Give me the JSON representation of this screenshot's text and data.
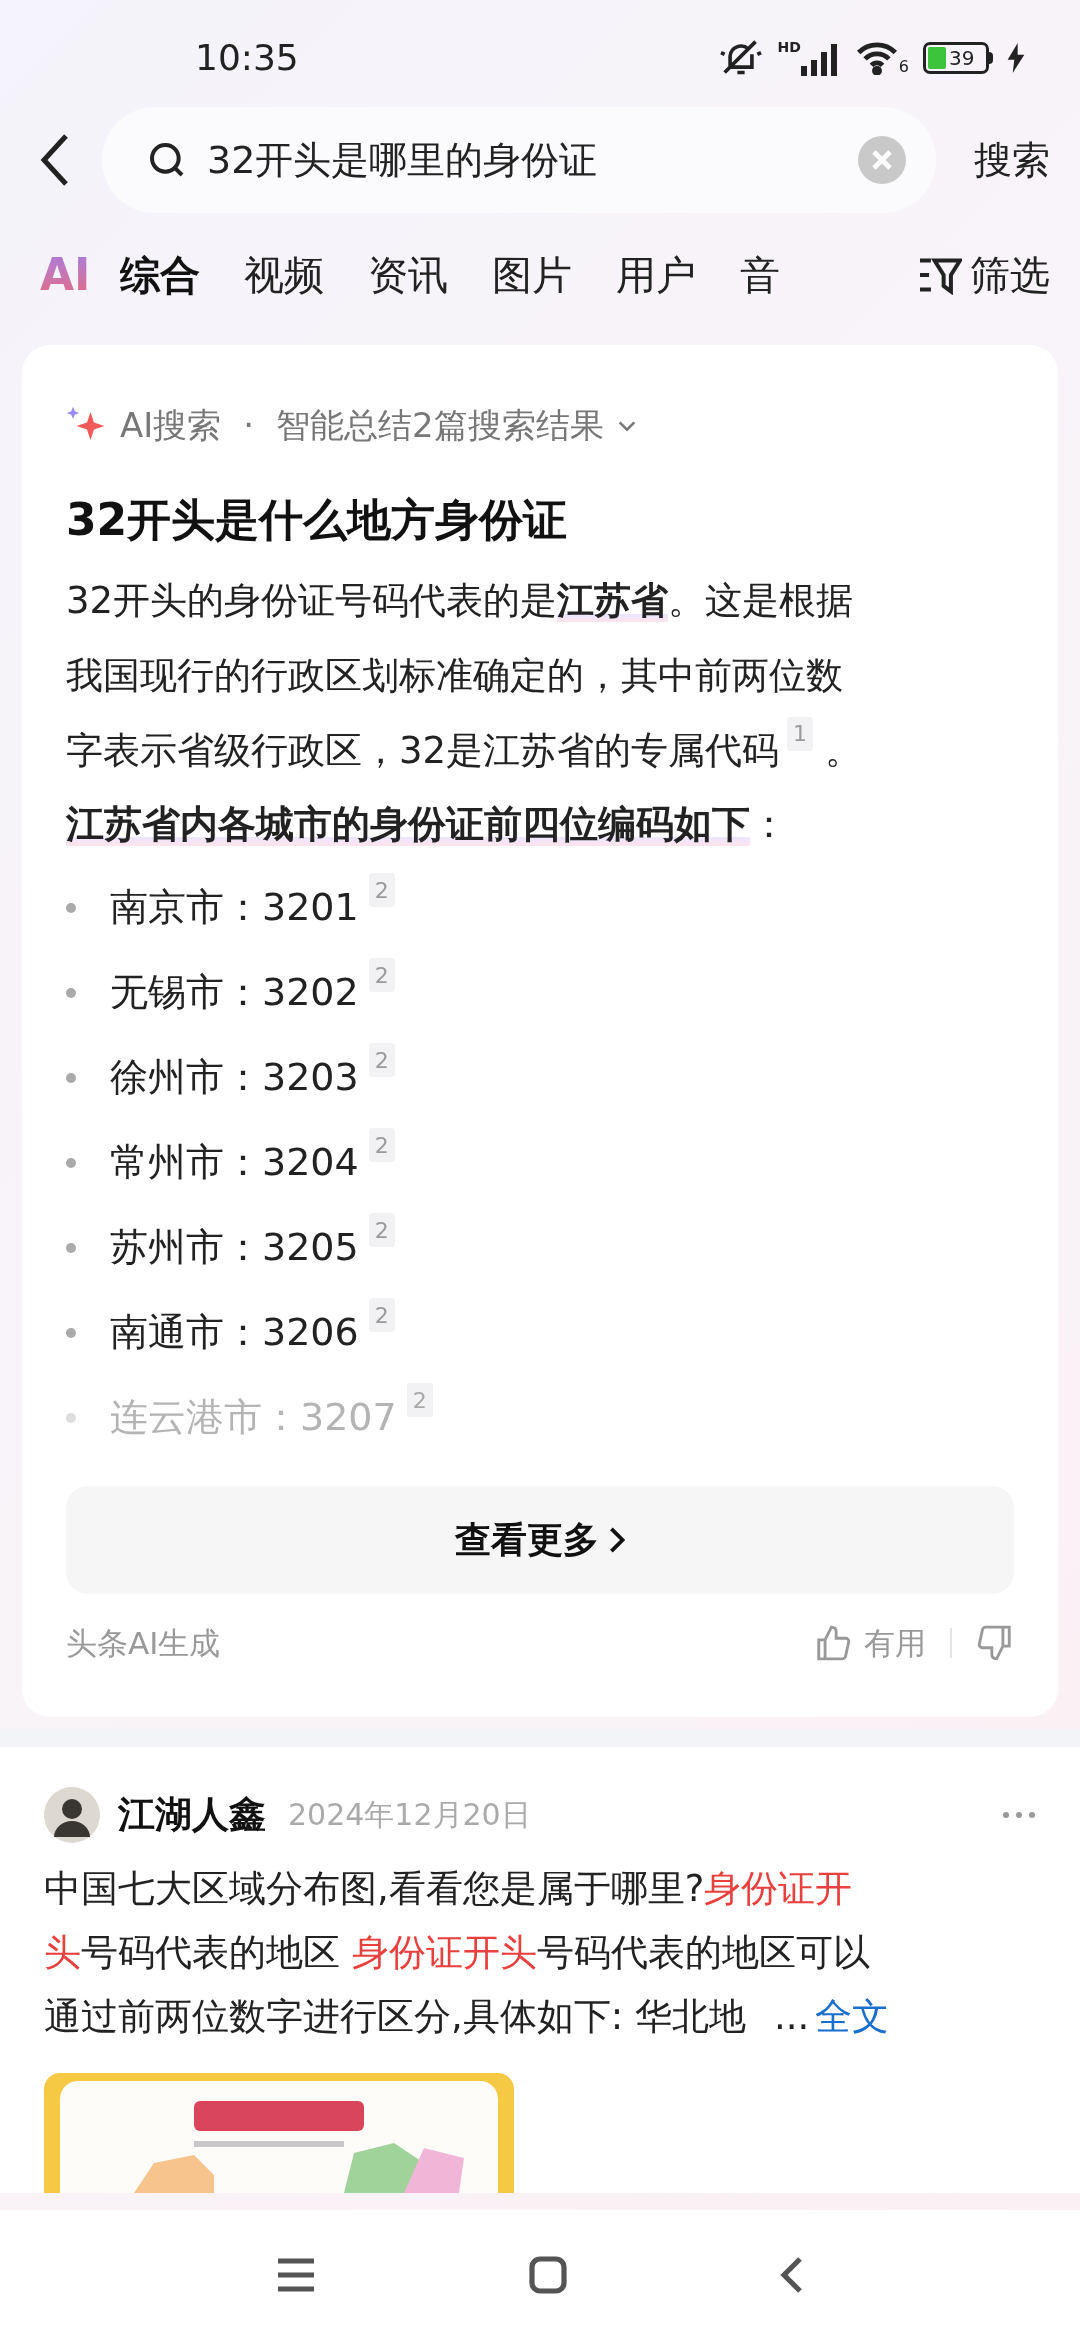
{
  "status_bar": {
    "time": "10:35",
    "network": "HD",
    "wifi_badge": "6",
    "battery": "39"
  },
  "search": {
    "query": "32开头是哪里的身份证",
    "button": "搜索"
  },
  "tabs_logo": "AI",
  "tabs": [
    {
      "label": "综合",
      "selected": true
    },
    {
      "label": "视频",
      "selected": false
    },
    {
      "label": "资讯",
      "selected": false
    },
    {
      "label": "图片",
      "selected": false
    },
    {
      "label": "用户",
      "selected": false
    },
    {
      "label": "音",
      "selected": false
    }
  ],
  "filter": "筛选",
  "ai_card": {
    "source": "AI搜索",
    "separator": "·",
    "summary_info": "智能总结2篇搜索结果",
    "title": "32开头是什么地方身份证",
    "paragraph": {
      "lines": [
        "32开头的身份证号码代表的是**江苏省**。这是根据",
        "我国现行的行政区划标准确定的，其中前两位数",
        "字表示省级行政区，32是江苏省的专属代码"
      ],
      "cite": "1",
      "end": "。"
    },
    "subheading": "**江苏省内各城市的身份证前四位编码如下**：",
    "items": [
      {
        "text": "南京市：3201",
        "cite": "2",
        "faded": false
      },
      {
        "text": "无锡市：3202",
        "cite": "2",
        "faded": false
      },
      {
        "text": "徐州市：3203",
        "cite": "2",
        "faded": false
      },
      {
        "text": "常州市：3204",
        "cite": "2",
        "faded": false
      },
      {
        "text": "苏州市：3205",
        "cite": "2",
        "faded": false
      },
      {
        "text": "南通市：3206",
        "cite": "2",
        "faded": false
      },
      {
        "text": "连云港市：3207",
        "cite": "2",
        "faded": true
      }
    ],
    "more_button": "查看更多",
    "footer": "头条AI生成",
    "useful": "有用"
  },
  "post": {
    "author": "江湖人鑫",
    "date": "2024年12月20日",
    "body": [
      [
        {
          "text": "中国七大区域分布图,看看您是属于哪里?",
          "highlight": false
        },
        {
          "text": "身份证开",
          "highlight": true
        }
      ],
      [
        {
          "text": "头",
          "highlight": true
        },
        {
          "text": "号码代表的地区 ",
          "highlight": false
        },
        {
          "text": "身份证开头",
          "highlight": true
        },
        {
          "text": "号码代表的地区可以",
          "highlight": false
        }
      ],
      [
        {
          "text": "通过前两位数字进行区分,具体如下: 华北地",
          "highlight": false
        }
      ]
    ],
    "ellipsis": "...",
    "full_text": "全文",
    "image": {
      "kind": "picture"
    }
  }
}
